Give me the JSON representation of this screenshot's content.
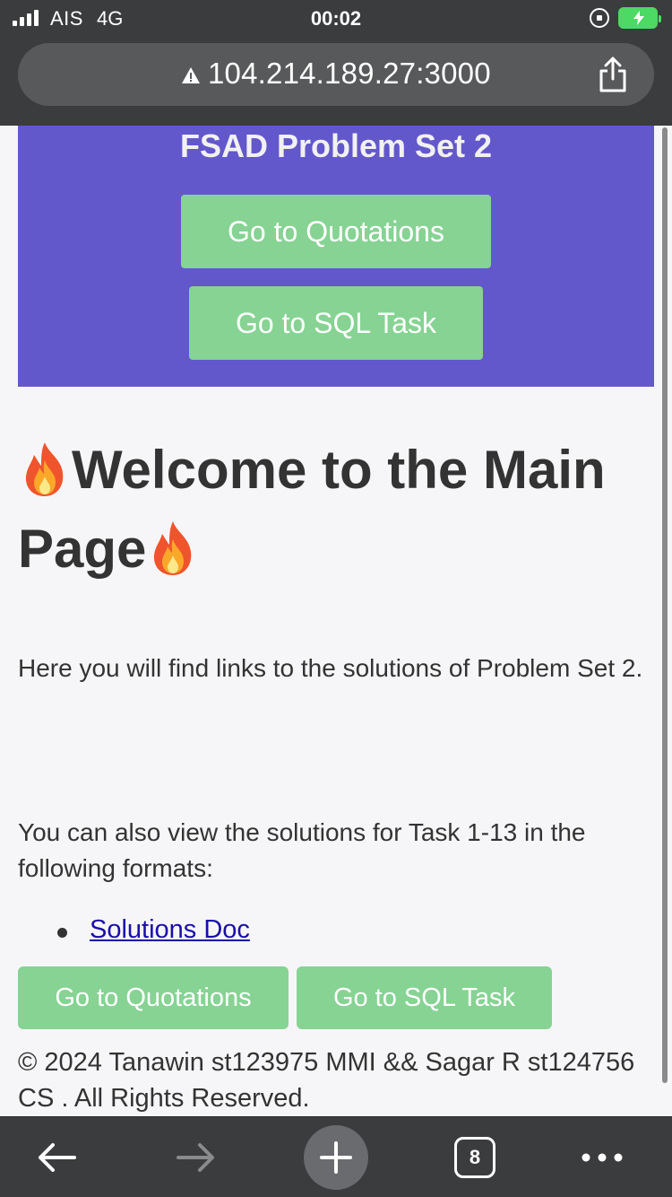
{
  "status_bar": {
    "carrier": "AIS",
    "network": "4G",
    "time": "00:02"
  },
  "browser": {
    "url": "104.214.189.27:3000",
    "tab_count": "8"
  },
  "hero": {
    "title": "FSAD Problem Set 2",
    "btn_quotations": "Go to Quotations",
    "btn_sql": "Go to SQL Task",
    "background": "#6357cc"
  },
  "main": {
    "heading_line1": "Welcome to the Main",
    "heading_line2": "Page",
    "paragraph1": "Here you will find links to the solutions of Problem Set 2.",
    "paragraph2": "You can also view the solutions for Task 1-13 in the following formats:",
    "links": [
      "Solutions Doc"
    ],
    "btn_quotations": "Go to Quotations",
    "btn_sql": "Go to SQL Task",
    "button_color": "#86d393"
  },
  "footer": {
    "text": "© 2024 Tanawin st123975 MMI && Sagar R st124756 CS . All Rights Reserved."
  },
  "icons": {
    "heading_decoration": "fire-emoji",
    "toolbar": [
      "back-arrow-icon",
      "forward-arrow-icon",
      "plus-icon",
      "tabs-icon",
      "more-icon"
    ]
  }
}
